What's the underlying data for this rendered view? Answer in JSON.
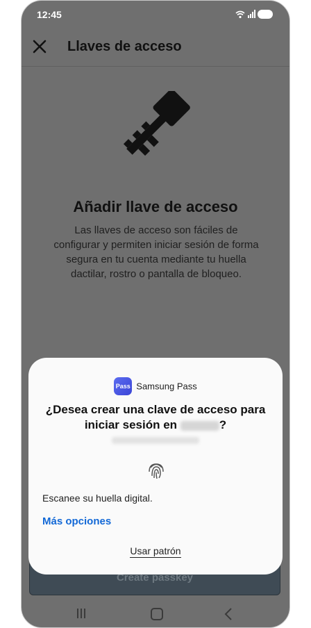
{
  "status_bar": {
    "time": "12:45",
    "icons": [
      "wifi-icon",
      "signal-icon",
      "battery-icon"
    ]
  },
  "app_bar": {
    "title": "Llaves de acceso",
    "close_icon": "close-icon"
  },
  "main": {
    "illustration": "key-icon",
    "heading": "Añadir llave de acceso",
    "description": "Las llaves de acceso son fáciles de configurar y permiten iniciar sesión de forma segura en tu cuenta mediante tu huella dactilar, rostro o pantalla de bloqueo.",
    "create_button": "Create passkey"
  },
  "sheet": {
    "provider_logo": "Pass",
    "provider_name": "Samsung Pass",
    "question_prefix": "¿Desea crear una clave de acceso para iniciar sesión en",
    "question_suffix": "?",
    "fingerprint_icon": "fingerprint-icon",
    "scan_text": "Escanee su huella digital.",
    "more_options": "Más opciones",
    "use_pattern": "Usar patrón"
  },
  "nav_bar": {
    "icons": [
      "recent-apps-icon",
      "home-icon",
      "back-icon"
    ]
  },
  "colors": {
    "accent": "#1268d6",
    "scrim": "#6f6f6f",
    "sheet": "#fafafa"
  }
}
